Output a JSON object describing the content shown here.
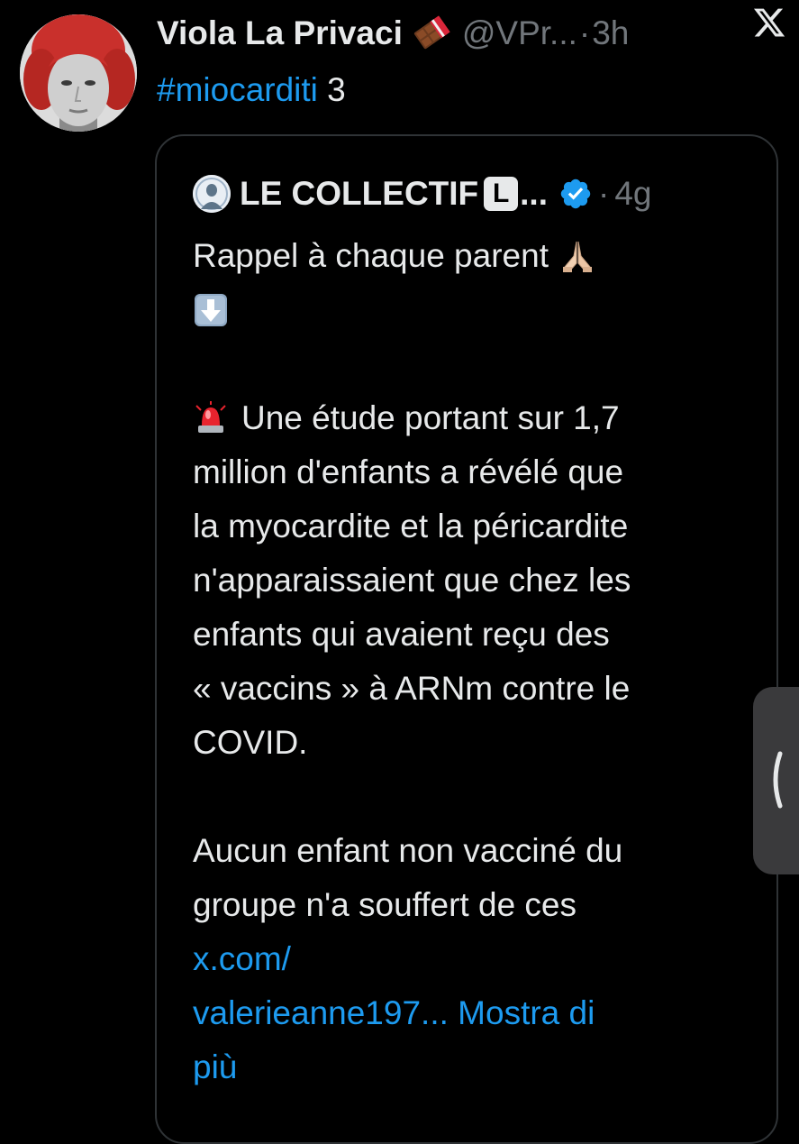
{
  "post": {
    "display_name": "Viola La Privaci",
    "name_emoji": "chocolate-bar-icon",
    "handle": "@VPr...",
    "separator": "·",
    "time": "3h",
    "hashtag": "#miocarditi",
    "text_suffix": " 3"
  },
  "quoted_post": {
    "name": "LE COLLECTIF",
    "badge_letter": "L",
    "ellipsis": "...",
    "separator": "·",
    "time": "4g",
    "lines": {
      "l1": "Rappel à chaque parent",
      "l4": "Une étude portant sur 1,7",
      "l5": "million d'enfants a révélé que",
      "l6": "la myocardite et la péricardite",
      "l7": "n'apparaissaient que chez les",
      "l8": "enfants qui avaient reçu des",
      "l9": "« vaccins » à ARNm contre le",
      "l10": "COVID.",
      "l12": "Aucun enfant non vacciné du",
      "l13": "groupe n'a souffert de ces",
      "link1": "x.com/",
      "link2": "valerieanne197...",
      "show_more_1": "Mostra di",
      "show_more_2": "più"
    }
  },
  "colors": {
    "background": "#000000",
    "text": "#e7e9ea",
    "secondary": "#71767b",
    "link": "#1d9bf0",
    "card_border": "#2f3336"
  }
}
